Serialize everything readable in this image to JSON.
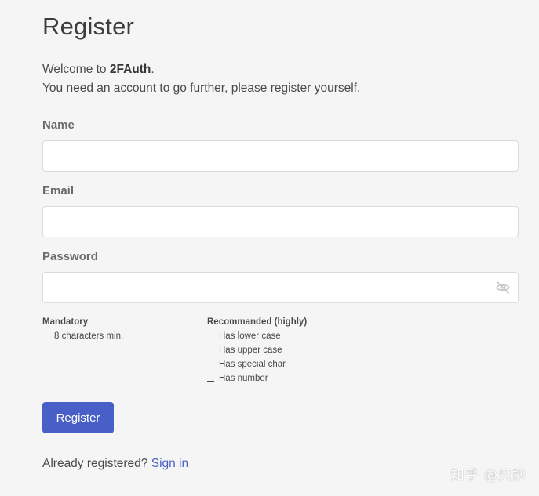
{
  "page": {
    "title": "Register"
  },
  "intro": {
    "welcome_prefix": "Welcome to ",
    "app_name": "2FAuth",
    "welcome_suffix": ".",
    "line2": "You need an account to go further, please register yourself."
  },
  "form": {
    "name": {
      "label": "Name",
      "value": ""
    },
    "email": {
      "label": "Email",
      "value": ""
    },
    "password": {
      "label": "Password",
      "value": "",
      "toggle_icon": "eye-slash-icon"
    }
  },
  "password_rules": {
    "mandatory": {
      "title": "Mandatory",
      "items": [
        "8 characters min."
      ]
    },
    "recommended": {
      "title": "Recommanded (highly)",
      "items": [
        "Has lower case",
        "Has upper case",
        "Has special char",
        "Has number"
      ]
    }
  },
  "actions": {
    "register_label": "Register"
  },
  "footer": {
    "already_registered": "Already registered?",
    "sign_in_label": "Sign in"
  },
  "watermark": {
    "text": "知乎 @只抄"
  },
  "colors": {
    "background": "#f5f5f5",
    "primary": "#485fc7",
    "input_border": "#dbdbdb",
    "label": "#6b6b6b"
  }
}
